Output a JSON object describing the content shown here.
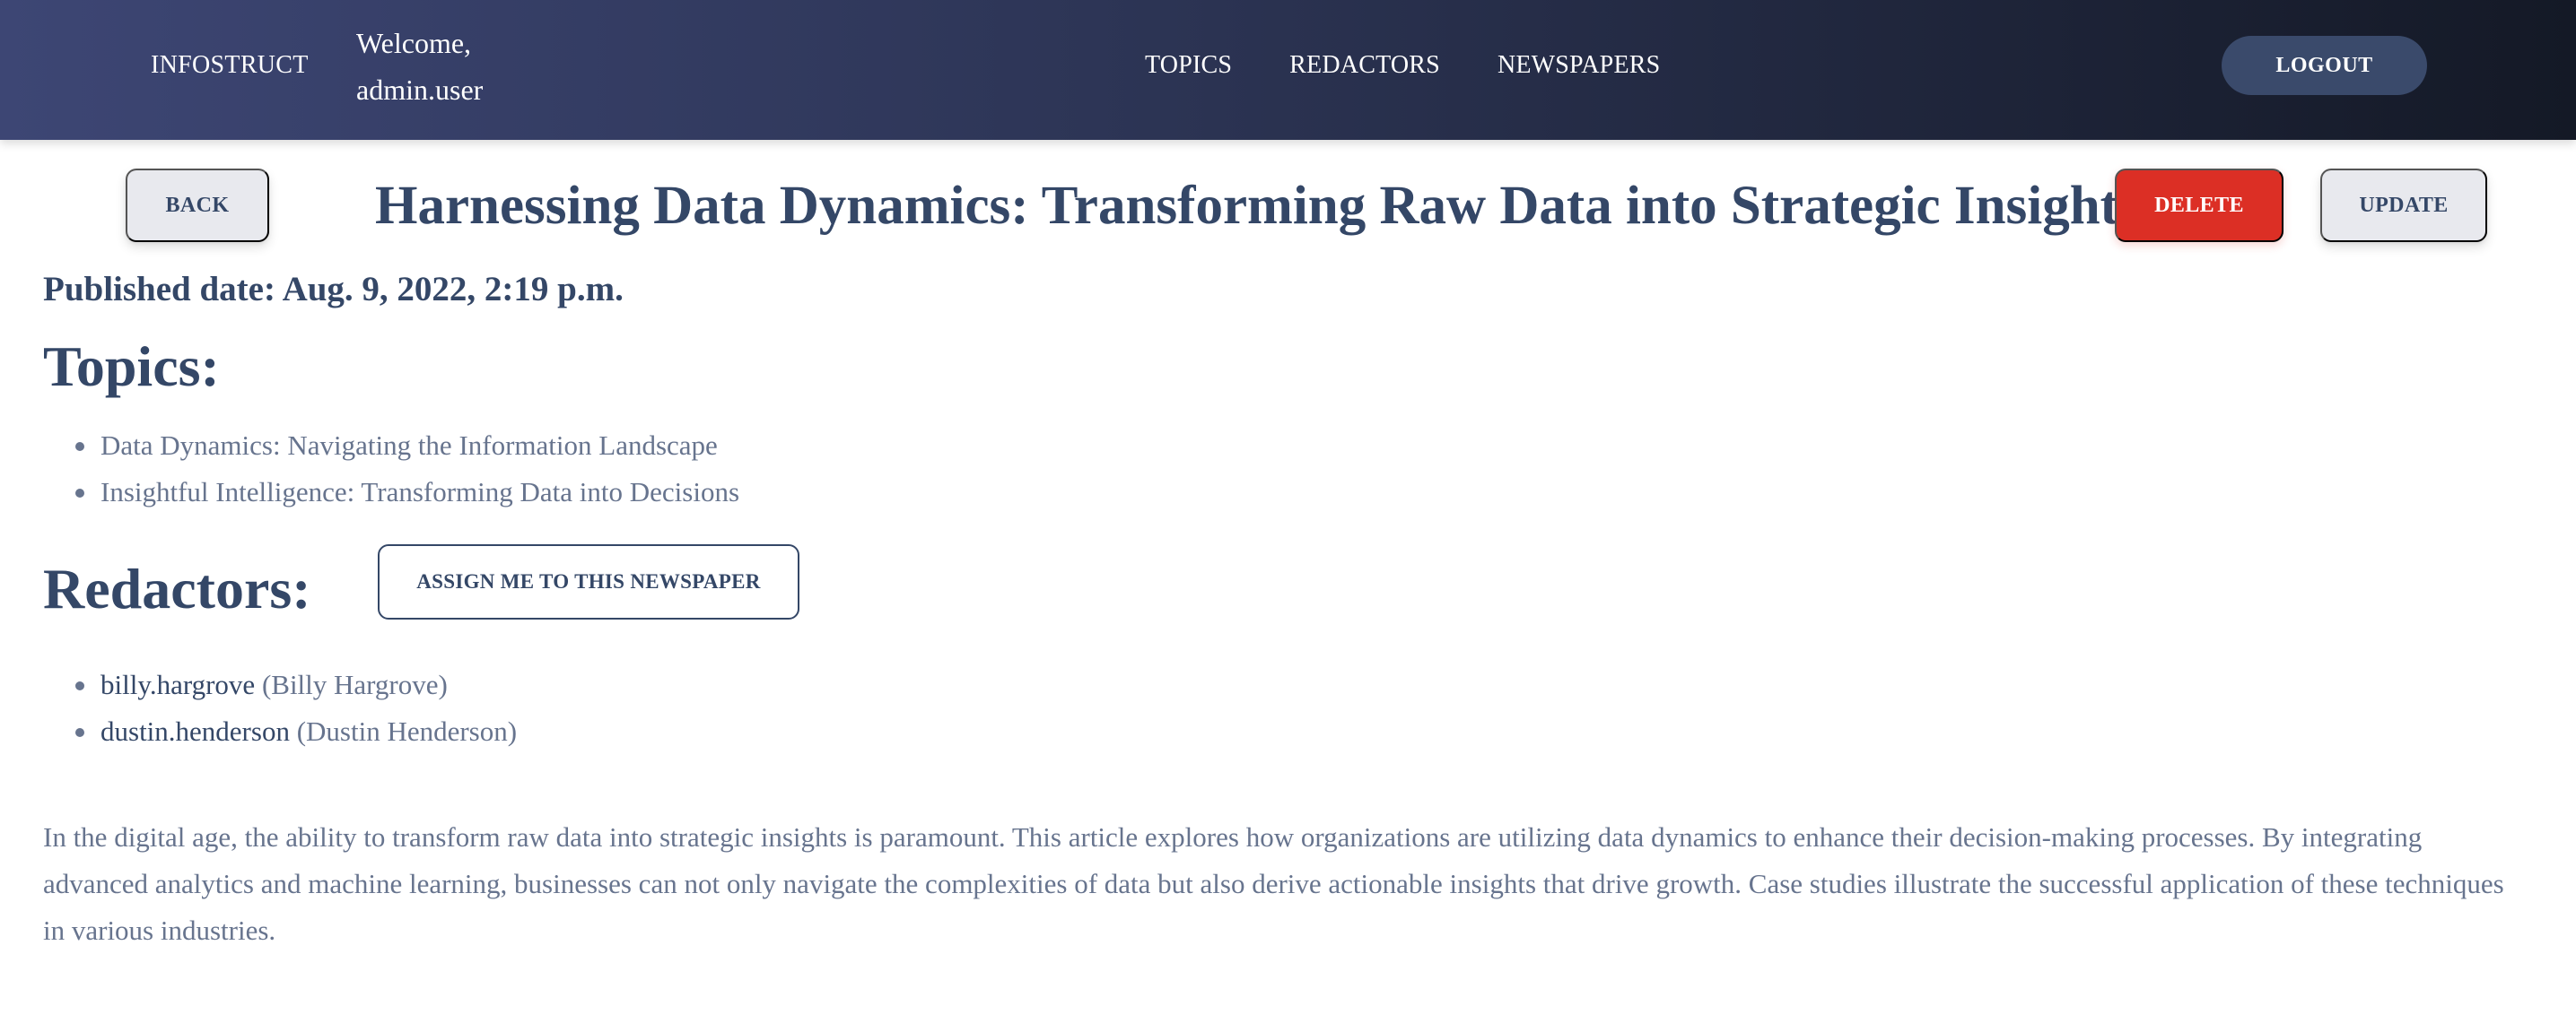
{
  "navbar": {
    "brand": "INFOSTRUCT",
    "welcome_line1": "Welcome,",
    "welcome_line2": "admin.user",
    "links": [
      {
        "label": "TOPICS"
      },
      {
        "label": "REDACTORS"
      },
      {
        "label": "NEWSPAPERS"
      }
    ],
    "logout_label": "LOGOUT"
  },
  "header": {
    "back_label": "BACK",
    "title": "Harnessing Data Dynamics: Transforming Raw Data into Strategic Insights",
    "delete_label": "DELETE",
    "update_label": "UPDATE"
  },
  "article": {
    "published": "Published date: Aug. 9, 2022, 2:19 p.m.",
    "topics_heading": "Topics:",
    "topics": [
      "Data Dynamics: Navigating the Information Landscape",
      "Insightful Intelligence: Transforming Data into Decisions"
    ],
    "redactors_heading": "Redactors:",
    "assign_label": "ASSIGN ME TO THIS NEWSPAPER",
    "redactors": [
      {
        "username": "billy.hargrove",
        "fullname": " (Billy Hargrove)"
      },
      {
        "username": "dustin.henderson",
        "fullname": " (Dustin Henderson)"
      }
    ],
    "body": "In the digital age, the ability to transform raw data into strategic insights is paramount. This article explores how organizations are utilizing data dynamics to enhance their decision-making processes. By integrating advanced analytics and machine learning, businesses can not only navigate the complexities of data but also derive actionable insights that drive growth. Case studies illustrate the successful application of these techniques in various industries."
  },
  "colors": {
    "navbar_start": "#3d4674",
    "navbar_end": "#141926",
    "heading": "#344767",
    "text_muted": "#67748e",
    "delete": "#dc2f25",
    "logout": "#3a4a6b"
  }
}
